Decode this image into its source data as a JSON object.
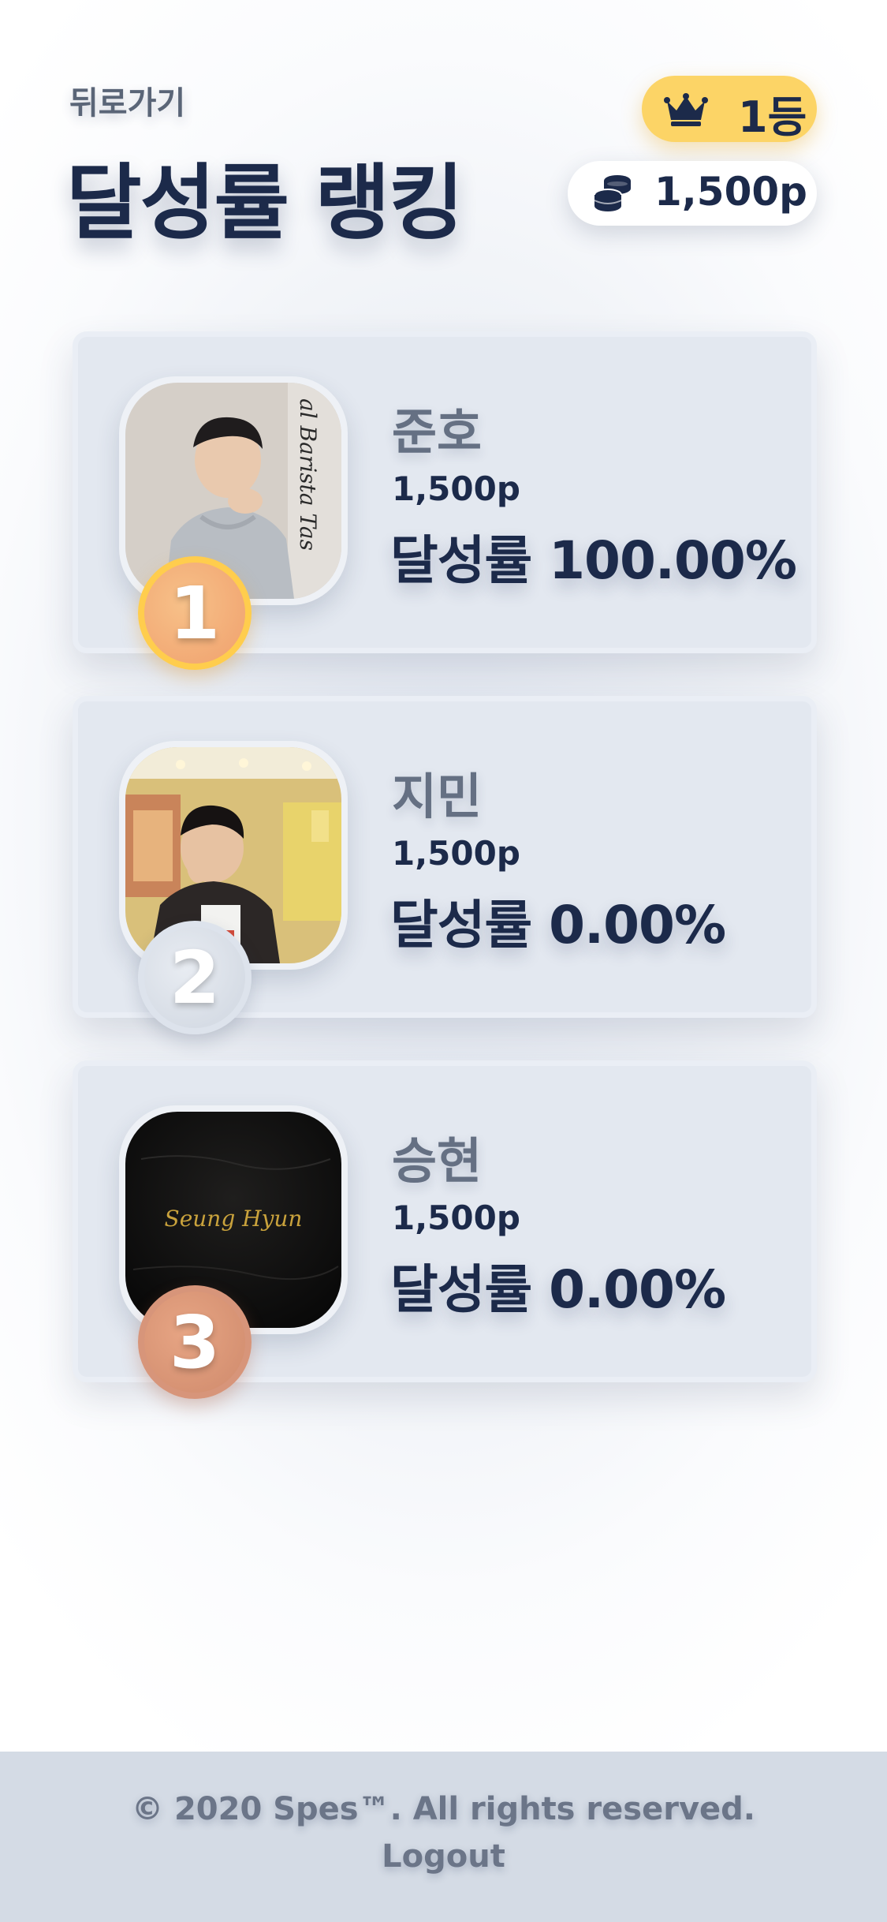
{
  "header": {
    "back_label": "뒤로가기",
    "title": "달성률 랭킹",
    "rank_label": "1등",
    "points_label": "1,500p",
    "crown_icon": "crown-icon",
    "coins_icon": "coins-icon",
    "rank_badge_color": "#fcd466"
  },
  "rankings": [
    {
      "rank": "1",
      "name": "준호",
      "points": "1,500p",
      "rate": "달성률 100.00%",
      "medal_color": "#ffcd4d"
    },
    {
      "rank": "2",
      "name": "지민",
      "points": "1,500p",
      "rate": "달성률 0.00%",
      "medal_color": "#dde3ec"
    },
    {
      "rank": "3",
      "name": "승현",
      "points": "1,500p",
      "rate": "달성률 0.00%",
      "medal_color": "#d7957a",
      "photo_caption": "Seung Hyun"
    }
  ],
  "footer": {
    "copyright": "© 2020 Spes™. All rights reserved.",
    "logout_label": "Logout"
  },
  "colors": {
    "primary_text": "#1c2a4a",
    "muted_text": "#657083",
    "card_bg": "#e3e8f0",
    "footer_bg": "#d4dbe5"
  }
}
